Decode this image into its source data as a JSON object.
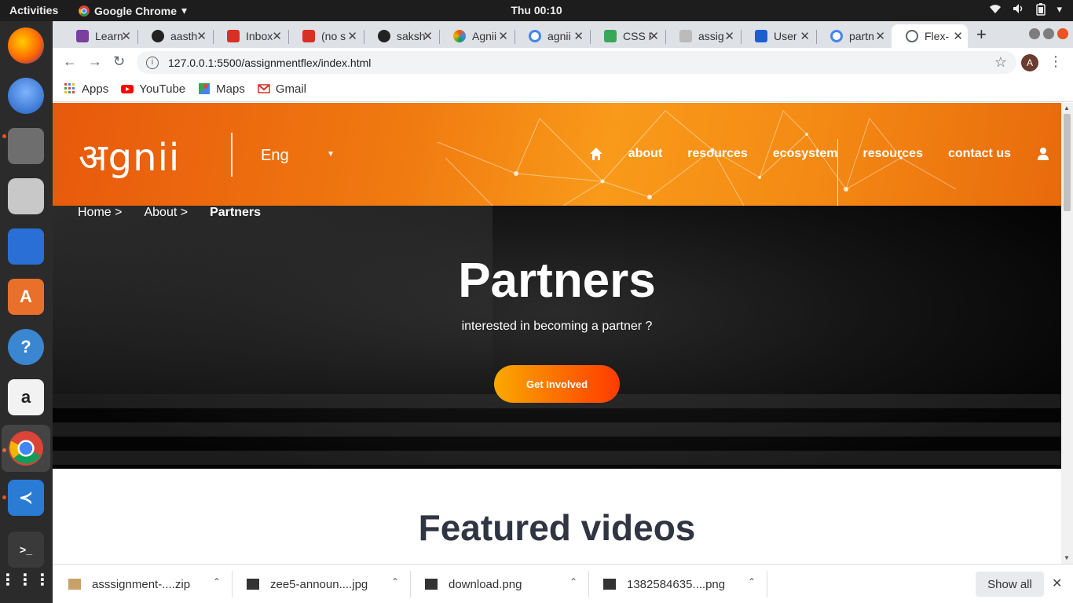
{
  "system": {
    "activities": "Activities",
    "app_name": "Google Chrome",
    "clock": "Thu 00:10"
  },
  "tabs": [
    {
      "label": "Learn",
      "color": "#7b3fa0",
      "icon": "learn-favicon"
    },
    {
      "label": "aasth",
      "color": "#222222",
      "icon": "github-icon"
    },
    {
      "label": "Inbox",
      "color": "#d93025",
      "icon": "gmail-icon"
    },
    {
      "label": "(no s",
      "color": "#d93025",
      "icon": "gmail-icon"
    },
    {
      "label": "saksh",
      "color": "#222222",
      "icon": "github-icon"
    },
    {
      "label": "Agnii",
      "color": "#e8590c",
      "icon": "agnii-favicon"
    },
    {
      "label": "agnii",
      "color": "#4285f4",
      "icon": "google-icon"
    },
    {
      "label": "CSS F",
      "color": "#3aa757",
      "icon": "css-favicon"
    },
    {
      "label": "assig",
      "color": "#666666",
      "icon": "doc-favicon"
    },
    {
      "label": "User",
      "color": "#1a5fd0",
      "icon": "flag-favicon"
    },
    {
      "label": "partn",
      "color": "#4285f4",
      "icon": "google-icon"
    },
    {
      "label": "Flex-",
      "color": "#5f6368",
      "icon": "globe-icon",
      "active": true
    }
  ],
  "address": {
    "url": "127.0.0.1:5500/assignmentflex/index.html",
    "profile_initial": "A"
  },
  "bookmarks": [
    {
      "label": "Apps",
      "icon": "apps-grid-icon"
    },
    {
      "label": "YouTube",
      "icon": "youtube-icon"
    },
    {
      "label": "Maps",
      "icon": "maps-icon"
    },
    {
      "label": "Gmail",
      "icon": "gmail-icon"
    }
  ],
  "site": {
    "logo": "अgnii",
    "language": "Eng",
    "nav": {
      "about": "about",
      "resources": "resources",
      "ecosystem": "ecosystem",
      "resources2": "resources",
      "contact": "contact us"
    },
    "breadcrumb": {
      "home": "Home  >",
      "about": "About  >",
      "current": "Partners"
    },
    "hero_title": "Partners",
    "hero_subtitle": "interested in becoming a partner ?",
    "cta": "Get Involved",
    "featured_title": "Featured videos",
    "brand_color": "#f07a10"
  },
  "downloads": [
    {
      "name": "asssignment-....zip",
      "icon": "archive-icon"
    },
    {
      "name": "zee5-announ....jpg",
      "icon": "image-file-icon"
    },
    {
      "name": "download.png",
      "icon": "image-file-icon"
    },
    {
      "name": "1382584635....png",
      "icon": "image-file-icon"
    }
  ],
  "downloads_show_all": "Show all"
}
